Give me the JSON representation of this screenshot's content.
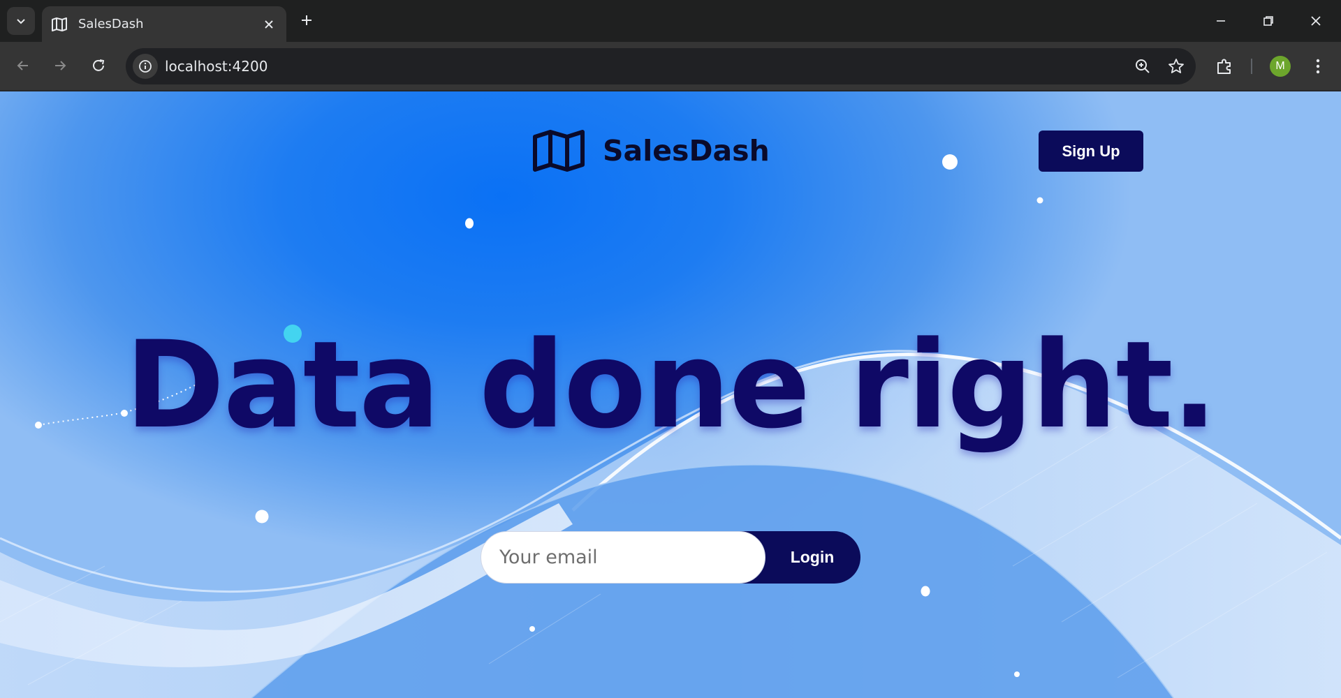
{
  "browser": {
    "tab_title": "SalesDash",
    "url": "localhost:4200",
    "profile_initial": "M"
  },
  "page": {
    "brand_name": "SalesDash",
    "signup_label": "Sign Up",
    "headline": "Data done right.",
    "email_placeholder": "Your email",
    "login_label": "Login"
  },
  "colors": {
    "primary_navy": "#0b0b5a",
    "headline": "#0f0966",
    "background_blue": "#0a71f5",
    "accent_cyan": "#43d4f0",
    "avatar": "#6da62c"
  }
}
